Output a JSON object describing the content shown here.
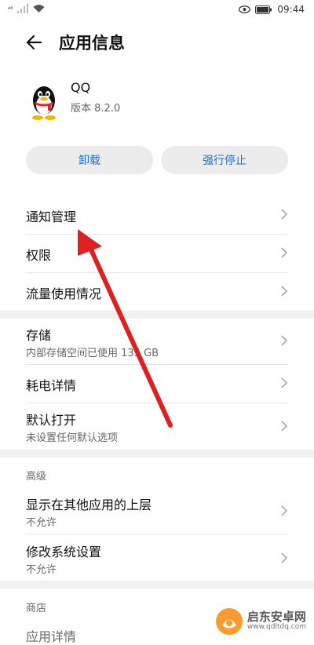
{
  "status_bar": {
    "left_text": "⁴⁶",
    "time": "09:44"
  },
  "header": {
    "title": "应用信息"
  },
  "app": {
    "name": "QQ",
    "version": "版本 8.2.0"
  },
  "actions": {
    "uninstall": "卸载",
    "force_stop": "强行停止"
  },
  "group1": [
    {
      "title": "通知管理"
    },
    {
      "title": "权限"
    },
    {
      "title": "流量使用情况"
    }
  ],
  "group2": [
    {
      "title": "存储",
      "subtitle": "内部存储空间已使用 135 GB"
    },
    {
      "title": "耗电详情"
    },
    {
      "title": "默认打开",
      "subtitle": "未设置任何默认选项"
    }
  ],
  "advanced": {
    "label": "高级",
    "items": [
      {
        "title": "显示在其他应用的上层",
        "subtitle": "不允许"
      },
      {
        "title": "修改系统设置",
        "subtitle": "不允许"
      }
    ]
  },
  "store": {
    "label": "商店",
    "items": [
      {
        "title": "应用详情"
      }
    ]
  },
  "watermark": {
    "name": "启东安卓网",
    "url": "www.qdltdq.com"
  },
  "colors": {
    "accent": "#1e6fd9",
    "annotation_arrow": "#e02020"
  }
}
